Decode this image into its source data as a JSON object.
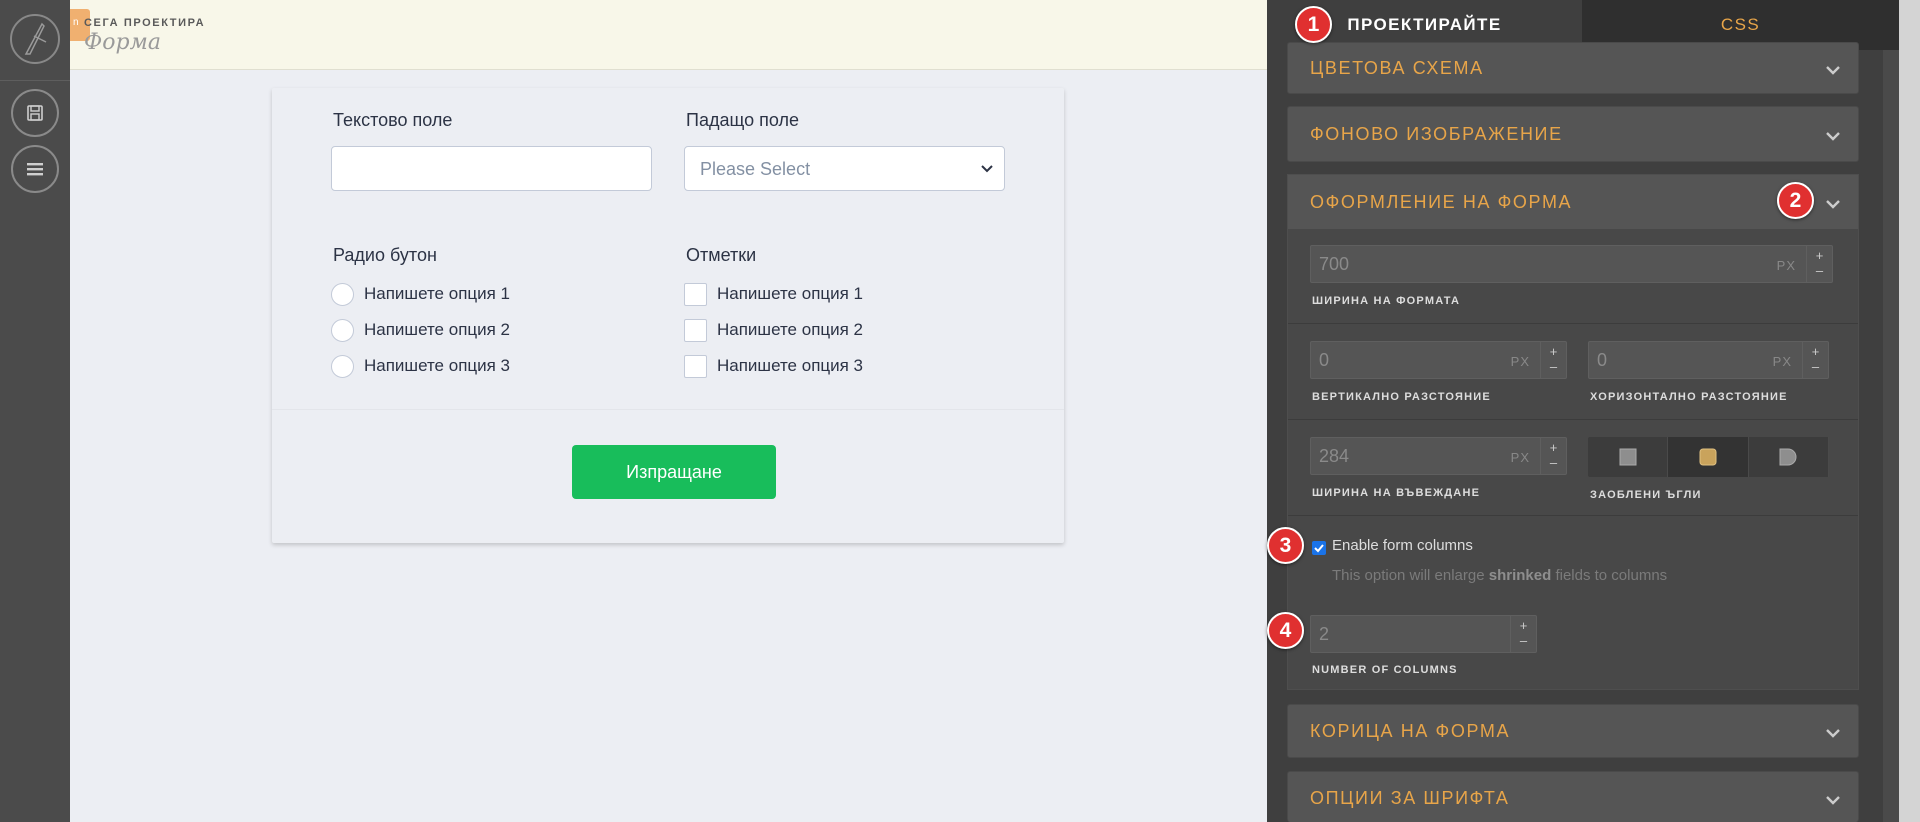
{
  "header": {
    "eyebrow": "СЕГА ПРОЕКТИРА",
    "form_title": "Форма",
    "tag": "n"
  },
  "form": {
    "text_field_label": "Текстово поле",
    "dropdown_label": "Падащо поле",
    "dropdown_placeholder": "Please Select",
    "radio_label": "Радио бутон",
    "checkbox_label": "Отметки",
    "radio_options": [
      "Напишете опция 1",
      "Напишете опция 2",
      "Напишете опция 3"
    ],
    "checkbox_options": [
      "Напишете опция 1",
      "Напишете опция 2",
      "Напишете опция 3"
    ],
    "submit_label": "Изпращане"
  },
  "panel": {
    "tabs": {
      "design": "ПРОЕКТИРАЙТЕ",
      "css": "CSS"
    },
    "sections": {
      "color_scheme": "ЦВЕТОВА СХЕМА",
      "background_image": "ФОНОВО ИЗОБРАЖЕНИЕ",
      "form_layout": "ОФОРМЛЕНИЕ НА ФОРМА",
      "form_cover": "КОРИЦА НА ФОРМА",
      "font_options": "ОПЦИИ ЗА ШРИФТА"
    },
    "form_width": {
      "value": "700",
      "unit": "PX",
      "label": "ШИРИНА НА ФОРМАТА"
    },
    "vertical_spacing": {
      "value": "0",
      "unit": "PX",
      "label": "ВЕРТИКАЛНО РАЗСТОЯНИЕ"
    },
    "horizontal_spacing": {
      "value": "0",
      "unit": "PX",
      "label": "ХОРИЗОНТАЛНО РАЗСТОЯНИЕ"
    },
    "input_width": {
      "value": "284",
      "unit": "PX",
      "label": "ШИРИНА НА ВЪВЕЖДАНЕ"
    },
    "rounded_corners": {
      "label": "ЗАОБЛЕНИ ЪГЛИ",
      "options": [
        "square",
        "rounded",
        "pill"
      ],
      "selected": "rounded"
    },
    "form_columns": {
      "checkbox_label": "Enable form columns",
      "checked": true,
      "desc_before": "This option will enlarge ",
      "desc_bold": "shrinked",
      "desc_after": " fields to columns"
    },
    "number_of_columns": {
      "value": "2",
      "label": "NUMBER OF COLUMNS"
    },
    "stepper": {
      "plus": "+",
      "minus": "–"
    }
  },
  "annotations": [
    "1",
    "2",
    "3",
    "4"
  ],
  "colors": {
    "accent": "#e8a549",
    "submit": "#18bd5b",
    "badge": "#e03030",
    "checkbox": "#1a73e8"
  }
}
